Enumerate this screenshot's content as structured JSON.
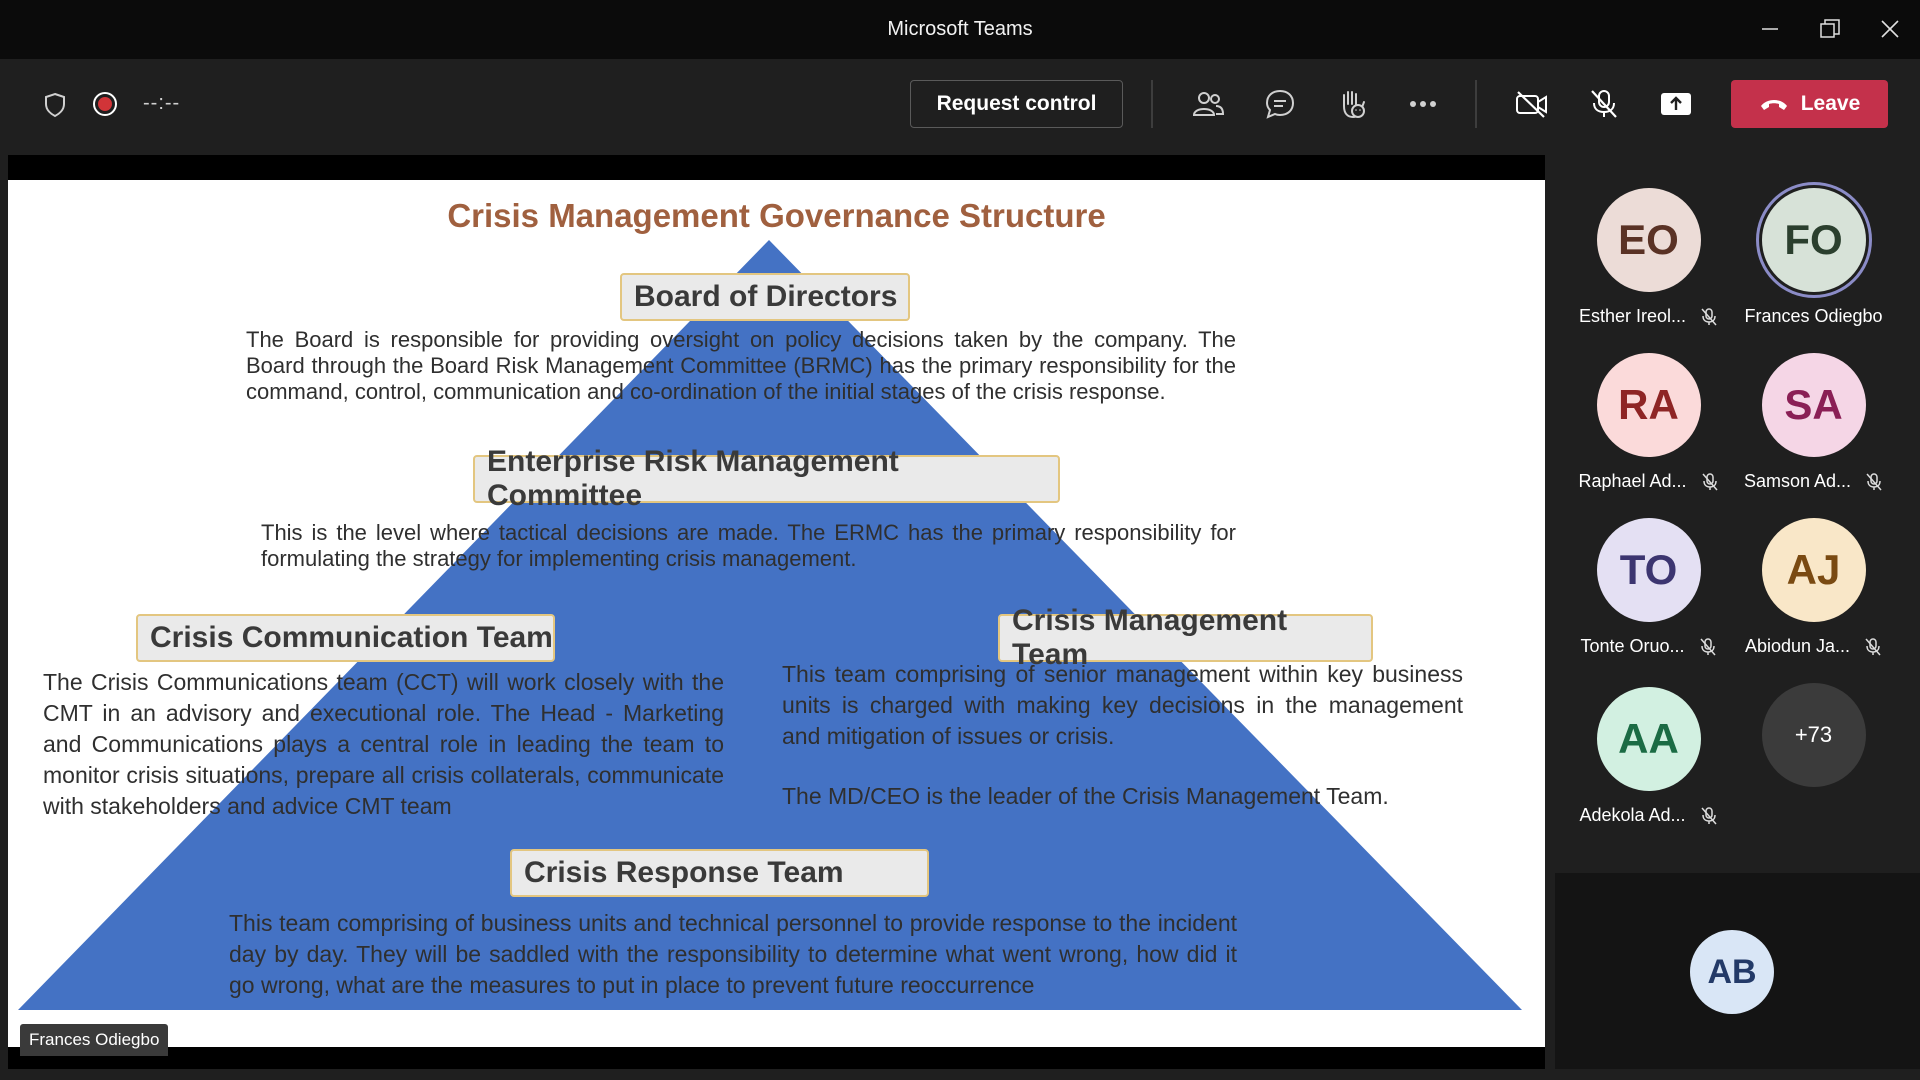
{
  "window": {
    "title": "Microsoft Teams"
  },
  "toolbar": {
    "timer": "--:--",
    "request_control": "Request control",
    "leave": "Leave",
    "icons": [
      "shield-icon",
      "record-icon",
      "people-icon",
      "chat-icon",
      "raise-hand-icon",
      "more-icon",
      "camera-off-icon",
      "mic-off-icon",
      "share-icon",
      "phone-hangup-icon"
    ]
  },
  "slide": {
    "title": "Crisis Management Governance Structure",
    "board": {
      "heading": "Board of Directors",
      "text": "The Board is responsible for providing oversight on policy decisions taken by the company. The Board through the Board Risk Management Committee (BRMC) has the primary responsibility for the command, control, communication and co-ordination of the initial stages of the crisis response."
    },
    "ermc": {
      "heading": "Enterprise Risk Management Committee",
      "text": "This is the level where tactical decisions are made. The ERMC has the primary responsibility for formulating the strategy for implementing crisis management."
    },
    "cct": {
      "heading": "Crisis Communication Team",
      "text": "The Crisis Communications team (CCT) will work closely with the CMT in an advisory and executional role. The  Head - Marketing and Communications plays a central role in leading the team to monitor crisis situations, prepare all crisis collaterals, communicate with stakeholders and advice CMT team"
    },
    "cmt": {
      "heading": "Crisis Management Team",
      "text": "This team comprising of senior management within key business units is charged with making key decisions in the management and mitigation of issues or crisis.",
      "text2": "The MD/CEO is the leader of the Crisis Management Team."
    },
    "crt": {
      "heading": "Crisis Response Team",
      "text": "This team comprising of business units and technical personnel to provide response to the incident day by day. They will be saddled with the responsibility to determine what went wrong, how did it go wrong, what are the measures to put in place to prevent future reoccurrence"
    },
    "colors": {
      "pyramid": "#4472c4",
      "title": "#a0603f",
      "box_border": "#e3c680"
    }
  },
  "presenter_label": "Frances Odiegbo",
  "participants": [
    {
      "initials": "EO",
      "name": "Esther Ireol...",
      "muted": true,
      "bg": "#ecdcd7",
      "fg": "#5a3225"
    },
    {
      "initials": "FO",
      "name": "Frances Odiegbo",
      "muted": false,
      "bg": "#d7e2d8",
      "fg": "#2b3f2e"
    },
    {
      "initials": "RA",
      "name": "Raphael Ad...",
      "muted": true,
      "bg": "#fbdada",
      "fg": "#8e2525"
    },
    {
      "initials": "SA",
      "name": "Samson Ad...",
      "muted": true,
      "bg": "#f5d6e6",
      "fg": "#8a1f55"
    },
    {
      "initials": "TO",
      "name": "Tonte Oruo...",
      "muted": true,
      "bg": "#e4e0f3",
      "fg": "#3c3570"
    },
    {
      "initials": "AJ",
      "name": "Abiodun Ja...",
      "muted": true,
      "bg": "#f9e7c8",
      "fg": "#7a4a12"
    },
    {
      "initials": "AA",
      "name": "Adekola Ad...",
      "muted": true,
      "bg": "#d2f0e1",
      "fg": "#1b6b44"
    }
  ],
  "overflow_count": "+73",
  "self_initials": "AB"
}
